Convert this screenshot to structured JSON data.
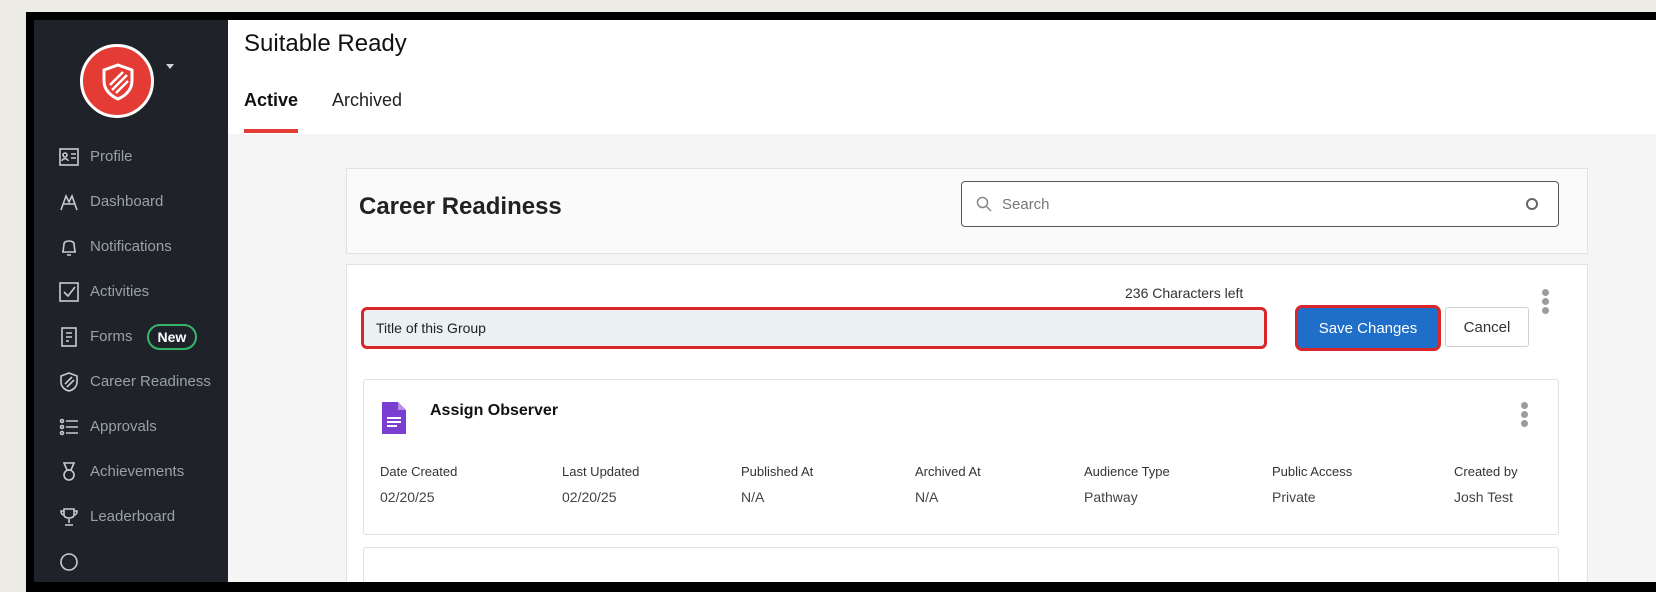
{
  "app": {
    "title": "Suitable Ready"
  },
  "tabs": [
    {
      "label": "Active"
    },
    {
      "label": "Archived"
    }
  ],
  "sidebar": {
    "items": [
      {
        "label": "Profile",
        "icon": "profile-icon"
      },
      {
        "label": "Dashboard",
        "icon": "dashboard-icon"
      },
      {
        "label": "Notifications",
        "icon": "bell-icon"
      },
      {
        "label": "Activities",
        "icon": "checkbox-icon"
      },
      {
        "label": "Forms",
        "icon": "form-icon",
        "badge": "New"
      },
      {
        "label": "Career Readiness",
        "icon": "shield-icon"
      },
      {
        "label": "Approvals",
        "icon": "list-icon"
      },
      {
        "label": "Achievements",
        "icon": "medal-icon"
      },
      {
        "label": "Leaderboard",
        "icon": "trophy-icon"
      }
    ]
  },
  "header": {
    "title": "Career Readiness"
  },
  "search": {
    "placeholder": "Search"
  },
  "group_editor": {
    "chars_left": "236 Characters left",
    "title_value": "Title of this Group",
    "save_label": "Save Changes",
    "cancel_label": "Cancel"
  },
  "activity": {
    "title": "Assign Observer",
    "fields": [
      {
        "label": "Date Created",
        "value": "02/20/25"
      },
      {
        "label": "Last Updated",
        "value": "02/20/25"
      },
      {
        "label": "Published At",
        "value": "N/A"
      },
      {
        "label": "Archived At",
        "value": "N/A"
      },
      {
        "label": "Audience Type",
        "value": "Pathway"
      },
      {
        "label": "Public Access",
        "value": "Private"
      },
      {
        "label": "Created by",
        "value": "Josh Test"
      }
    ]
  },
  "colors": {
    "accent": "#e43c35",
    "primary_button": "#1f6fc8",
    "sidebar_bg": "#1f2329",
    "badge_green": "#35b56a",
    "doc_icon": "#7a3fd1"
  }
}
